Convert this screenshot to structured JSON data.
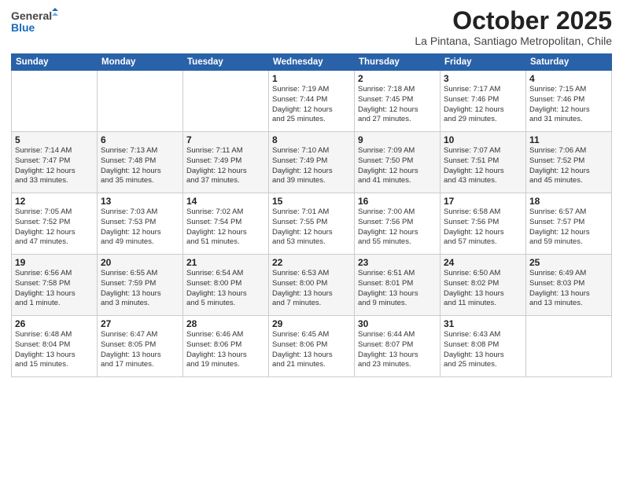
{
  "header": {
    "logo_general": "General",
    "logo_blue": "Blue",
    "month_title": "October 2025",
    "location": "La Pintana, Santiago Metropolitan, Chile"
  },
  "weekdays": [
    "Sunday",
    "Monday",
    "Tuesday",
    "Wednesday",
    "Thursday",
    "Friday",
    "Saturday"
  ],
  "weeks": [
    [
      {
        "day": "",
        "info": ""
      },
      {
        "day": "",
        "info": ""
      },
      {
        "day": "",
        "info": ""
      },
      {
        "day": "1",
        "info": "Sunrise: 7:19 AM\nSunset: 7:44 PM\nDaylight: 12 hours\nand 25 minutes."
      },
      {
        "day": "2",
        "info": "Sunrise: 7:18 AM\nSunset: 7:45 PM\nDaylight: 12 hours\nand 27 minutes."
      },
      {
        "day": "3",
        "info": "Sunrise: 7:17 AM\nSunset: 7:46 PM\nDaylight: 12 hours\nand 29 minutes."
      },
      {
        "day": "4",
        "info": "Sunrise: 7:15 AM\nSunset: 7:46 PM\nDaylight: 12 hours\nand 31 minutes."
      }
    ],
    [
      {
        "day": "5",
        "info": "Sunrise: 7:14 AM\nSunset: 7:47 PM\nDaylight: 12 hours\nand 33 minutes."
      },
      {
        "day": "6",
        "info": "Sunrise: 7:13 AM\nSunset: 7:48 PM\nDaylight: 12 hours\nand 35 minutes."
      },
      {
        "day": "7",
        "info": "Sunrise: 7:11 AM\nSunset: 7:49 PM\nDaylight: 12 hours\nand 37 minutes."
      },
      {
        "day": "8",
        "info": "Sunrise: 7:10 AM\nSunset: 7:49 PM\nDaylight: 12 hours\nand 39 minutes."
      },
      {
        "day": "9",
        "info": "Sunrise: 7:09 AM\nSunset: 7:50 PM\nDaylight: 12 hours\nand 41 minutes."
      },
      {
        "day": "10",
        "info": "Sunrise: 7:07 AM\nSunset: 7:51 PM\nDaylight: 12 hours\nand 43 minutes."
      },
      {
        "day": "11",
        "info": "Sunrise: 7:06 AM\nSunset: 7:52 PM\nDaylight: 12 hours\nand 45 minutes."
      }
    ],
    [
      {
        "day": "12",
        "info": "Sunrise: 7:05 AM\nSunset: 7:52 PM\nDaylight: 12 hours\nand 47 minutes."
      },
      {
        "day": "13",
        "info": "Sunrise: 7:03 AM\nSunset: 7:53 PM\nDaylight: 12 hours\nand 49 minutes."
      },
      {
        "day": "14",
        "info": "Sunrise: 7:02 AM\nSunset: 7:54 PM\nDaylight: 12 hours\nand 51 minutes."
      },
      {
        "day": "15",
        "info": "Sunrise: 7:01 AM\nSunset: 7:55 PM\nDaylight: 12 hours\nand 53 minutes."
      },
      {
        "day": "16",
        "info": "Sunrise: 7:00 AM\nSunset: 7:56 PM\nDaylight: 12 hours\nand 55 minutes."
      },
      {
        "day": "17",
        "info": "Sunrise: 6:58 AM\nSunset: 7:56 PM\nDaylight: 12 hours\nand 57 minutes."
      },
      {
        "day": "18",
        "info": "Sunrise: 6:57 AM\nSunset: 7:57 PM\nDaylight: 12 hours\nand 59 minutes."
      }
    ],
    [
      {
        "day": "19",
        "info": "Sunrise: 6:56 AM\nSunset: 7:58 PM\nDaylight: 13 hours\nand 1 minute."
      },
      {
        "day": "20",
        "info": "Sunrise: 6:55 AM\nSunset: 7:59 PM\nDaylight: 13 hours\nand 3 minutes."
      },
      {
        "day": "21",
        "info": "Sunrise: 6:54 AM\nSunset: 8:00 PM\nDaylight: 13 hours\nand 5 minutes."
      },
      {
        "day": "22",
        "info": "Sunrise: 6:53 AM\nSunset: 8:00 PM\nDaylight: 13 hours\nand 7 minutes."
      },
      {
        "day": "23",
        "info": "Sunrise: 6:51 AM\nSunset: 8:01 PM\nDaylight: 13 hours\nand 9 minutes."
      },
      {
        "day": "24",
        "info": "Sunrise: 6:50 AM\nSunset: 8:02 PM\nDaylight: 13 hours\nand 11 minutes."
      },
      {
        "day": "25",
        "info": "Sunrise: 6:49 AM\nSunset: 8:03 PM\nDaylight: 13 hours\nand 13 minutes."
      }
    ],
    [
      {
        "day": "26",
        "info": "Sunrise: 6:48 AM\nSunset: 8:04 PM\nDaylight: 13 hours\nand 15 minutes."
      },
      {
        "day": "27",
        "info": "Sunrise: 6:47 AM\nSunset: 8:05 PM\nDaylight: 13 hours\nand 17 minutes."
      },
      {
        "day": "28",
        "info": "Sunrise: 6:46 AM\nSunset: 8:06 PM\nDaylight: 13 hours\nand 19 minutes."
      },
      {
        "day": "29",
        "info": "Sunrise: 6:45 AM\nSunset: 8:06 PM\nDaylight: 13 hours\nand 21 minutes."
      },
      {
        "day": "30",
        "info": "Sunrise: 6:44 AM\nSunset: 8:07 PM\nDaylight: 13 hours\nand 23 minutes."
      },
      {
        "day": "31",
        "info": "Sunrise: 6:43 AM\nSunset: 8:08 PM\nDaylight: 13 hours\nand 25 minutes."
      },
      {
        "day": "",
        "info": ""
      }
    ]
  ]
}
